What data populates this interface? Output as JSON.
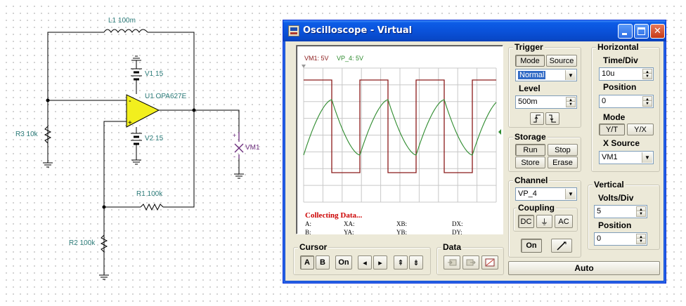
{
  "circuit": {
    "inductor_label": "L1 100m",
    "opamp_label": "U1 OPA627E",
    "v1_label": "V1 15",
    "v2_label": "V2 15",
    "r1_label": "R1 100k",
    "r2_label": "R2 100k",
    "r3_label": "R3 10k",
    "probe_label": "VM1",
    "plus_sign": "+",
    "minus_sign": "-"
  },
  "window": {
    "title": "Oscilloscope - Virtual",
    "controls": {
      "minimize": "_",
      "close": "✕"
    }
  },
  "screen": {
    "ch1_label": "VM1: 5V",
    "ch2_label": "VP_4: 5V",
    "status": "Collecting Data...",
    "readouts": {
      "a": "A:",
      "b": "B:",
      "xa": "XA:",
      "ya": "YA:",
      "xb": "XB:",
      "yb": "YB:",
      "dx": "DX:",
      "dy": "DY:"
    },
    "colors": {
      "ch1": "#8b1a1a",
      "ch2": "#2e8b2e",
      "grid": "#c8c8c8"
    }
  },
  "cursor": {
    "title": "Cursor",
    "buttons": [
      "A",
      "B",
      "On",
      "◂",
      "▸",
      "⇞",
      "⇟"
    ]
  },
  "data_group": {
    "title": "Data"
  },
  "trigger": {
    "title": "Trigger",
    "mode_label": "Mode",
    "source_label": "Source",
    "mode_value": "Normal",
    "level_label": "Level",
    "level_value": "500m"
  },
  "storage": {
    "title": "Storage",
    "run": "Run",
    "stop": "Stop",
    "store": "Store",
    "erase": "Erase"
  },
  "horizontal": {
    "title": "Horizontal",
    "time_div_label": "Time/Div",
    "time_div_value": "10u",
    "position_label": "Position",
    "position_value": "0",
    "mode_label": "Mode",
    "mode_yt": "Y/T",
    "mode_yx": "Y/X",
    "x_source_label": "X Source",
    "x_source_value": "VM1"
  },
  "channel": {
    "title": "Channel",
    "value": "VP_4",
    "coupling_title": "Coupling",
    "dc": "DC",
    "gnd": "⏚",
    "ac": "AC",
    "on": "On"
  },
  "vertical": {
    "title": "Vertical",
    "volts_div_label": "Volts/Div",
    "volts_div_value": "5",
    "position_label": "Position",
    "position_value": "0"
  },
  "auto_button": "Auto"
}
